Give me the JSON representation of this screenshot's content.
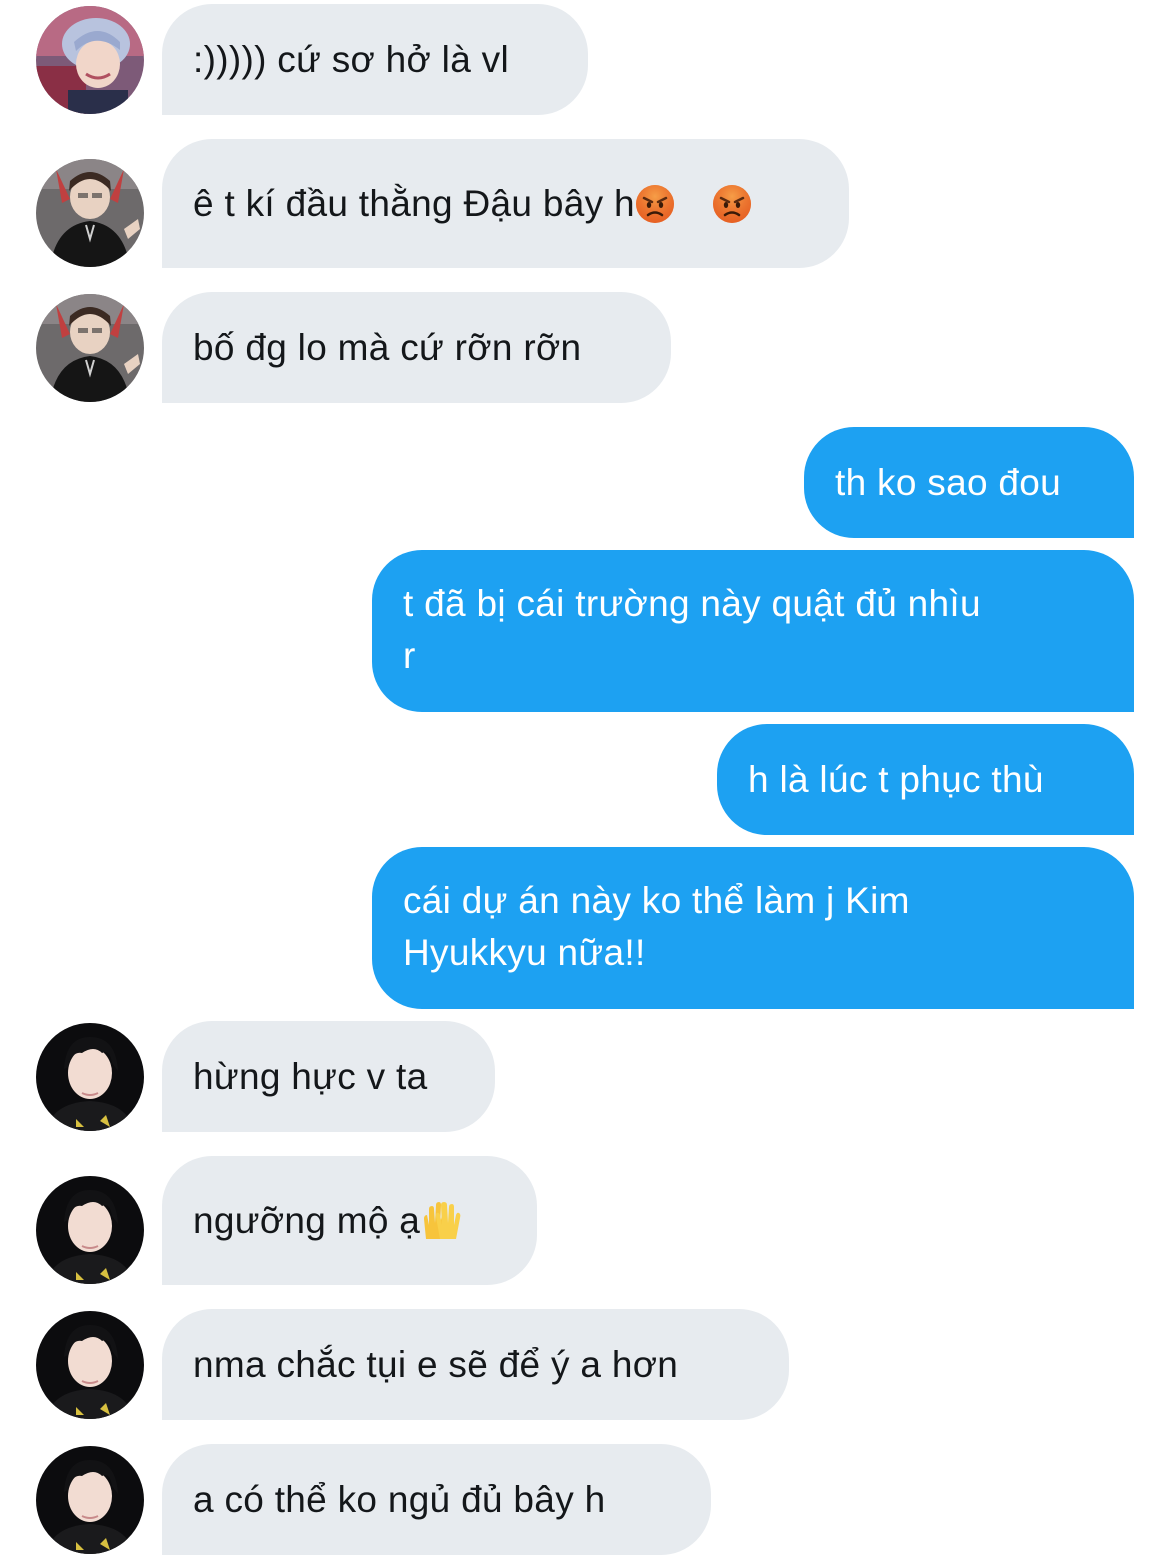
{
  "conversation": {
    "messages": [
      {
        "direction": "incoming",
        "avatar": "avatar-pink-hair-icon",
        "text": ":))))) cứ sơ hở là vl"
      },
      {
        "direction": "incoming",
        "avatar": "avatar-black-shirt-icon",
        "text": "ê t kí đầu thằng Đậu bây h",
        "emoji": [
          "angry-face-icon",
          "angry-face-icon"
        ]
      },
      {
        "direction": "incoming",
        "avatar": "avatar-black-shirt-icon",
        "text": "bố đg lo mà cứ rỡn rỡn"
      },
      {
        "direction": "outgoing",
        "text": "th ko sao đou"
      },
      {
        "direction": "outgoing",
        "text": "t đã bị cái trường này quật đủ nhìu\nr"
      },
      {
        "direction": "outgoing",
        "text": "h là lúc t phục thù"
      },
      {
        "direction": "outgoing",
        "text": "cái dự án này ko thể làm j Kim\nHyukkyu nữa!!"
      },
      {
        "direction": "incoming",
        "avatar": "avatar-dark-hair-icon",
        "text": "hừng hực v ta"
      },
      {
        "direction": "incoming",
        "avatar": "avatar-dark-hair-icon",
        "text": "ngưỡng mộ ạ",
        "emoji": [
          "raising-hands-icon"
        ]
      },
      {
        "direction": "incoming",
        "avatar": "avatar-dark-hair-icon",
        "text": "nma chắc tụi e sẽ để ý a hơn"
      },
      {
        "direction": "incoming",
        "avatar": "avatar-dark-hair-icon",
        "text": "a có thể ko ngủ đủ bây h"
      }
    ]
  },
  "colors": {
    "incoming_bubble": "#e7ebef",
    "incoming_text": "#14171a",
    "outgoing_bubble": "#1da1f2",
    "outgoing_text": "#ffffff"
  }
}
